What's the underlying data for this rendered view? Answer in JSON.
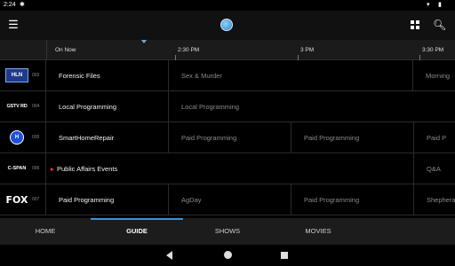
{
  "status_bar": {
    "time": "2:24",
    "icons": [
      "wifi-icon",
      "battery-icon"
    ]
  },
  "app_bar": {
    "icons": [
      "menu-icon",
      "app-logo-icon",
      "grid-view-icon",
      "search-icon"
    ]
  },
  "time_header": {
    "slots": [
      "On Now",
      "2:30 PM",
      "3 PM",
      "3:30 PM"
    ]
  },
  "guide": {
    "rows": [
      {
        "channel_logo": "HLN",
        "channel_number": "003",
        "programs": [
          {
            "title": "Forensic Files",
            "state": "current"
          },
          {
            "title": "Sex & Murder",
            "state": "future"
          },
          {
            "title": "Morning",
            "state": "future"
          }
        ]
      },
      {
        "channel_logo": "GSTV RD",
        "channel_number": "004",
        "programs": [
          {
            "title": "Local Programming",
            "state": "current"
          },
          {
            "title": "Local Programming",
            "state": "future"
          }
        ]
      },
      {
        "channel_logo": "H",
        "channel_number": "005",
        "programs": [
          {
            "title": "SmartHomeRepair",
            "state": "current"
          },
          {
            "title": "Paid Programming",
            "state": "future"
          },
          {
            "title": "Paid Programming",
            "state": "future"
          },
          {
            "title": "Paid P",
            "state": "future"
          }
        ]
      },
      {
        "channel_logo": "C-SPAN",
        "channel_number": "006",
        "programs": [
          {
            "title": "Public Affairs Events",
            "state": "current",
            "live": true
          },
          {
            "title": "Q&A",
            "state": "future"
          }
        ]
      },
      {
        "channel_logo": "FOX",
        "channel_number": "007",
        "programs": [
          {
            "title": "Paid Programming",
            "state": "current"
          },
          {
            "title": "AgDay",
            "state": "future"
          },
          {
            "title": "Paid Programming",
            "state": "future"
          },
          {
            "title": "Shephera",
            "state": "future"
          }
        ]
      }
    ]
  },
  "tabs": {
    "home": "HOME",
    "guide": "GUIDE",
    "shows": "SHOWS",
    "movies": "MOVIES",
    "active": "guide"
  },
  "colors": {
    "accent": "#3d8fd6",
    "live": "#e53935",
    "background": "#000000"
  }
}
